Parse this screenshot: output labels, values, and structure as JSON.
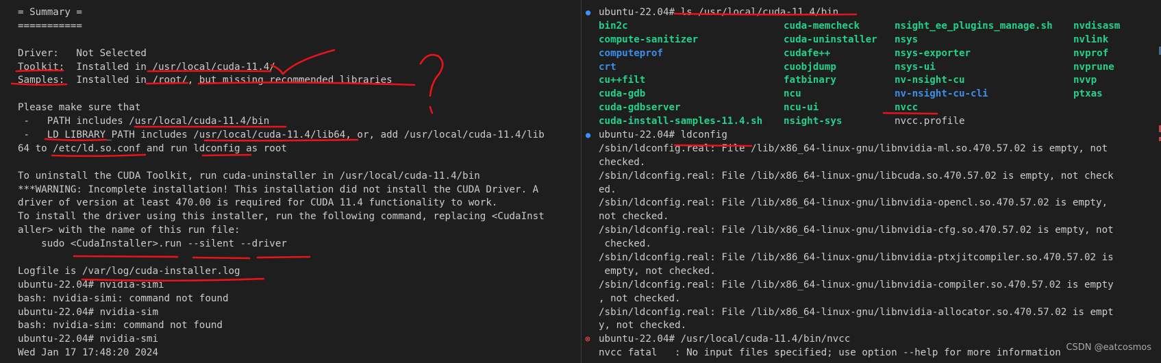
{
  "left_terminal": {
    "lines": [
      "= Summary =",
      "===========",
      "",
      "Driver:   Not Selected",
      "Toolkit:  Installed in /usr/local/cuda-11.4/",
      "Samples:  Installed in /root/, but missing recommended libraries",
      "",
      "Please make sure that",
      " -   PATH includes /usr/local/cuda-11.4/bin",
      " -   LD_LIBRARY_PATH includes /usr/local/cuda-11.4/lib64, or, add /usr/local/cuda-11.4/lib",
      "64 to /etc/ld.so.conf and run ldconfig as root",
      "",
      "To uninstall the CUDA Toolkit, run cuda-uninstaller in /usr/local/cuda-11.4/bin",
      "***WARNING: Incomplete installation! This installation did not install the CUDA Driver. A",
      "driver of version at least 470.00 is required for CUDA 11.4 functionality to work.",
      "To install the driver using this installer, run the following command, replacing <CudaInst",
      "aller> with the name of this run file:",
      "    sudo <CudaInstaller>.run --silent --driver",
      "",
      "Logfile is /var/log/cuda-installer.log",
      "ubuntu-22.04# nvidia-simi",
      "bash: nvidia-simi: command not found",
      "ubuntu-22.04# nvidia-sim",
      "bash: nvidia-sim: command not found",
      "ubuntu-22.04# nvidia-smi",
      "Wed Jan 17 17:48:20 2024"
    ]
  },
  "right_terminal": {
    "prompt1": "ubuntu-22.04# ls /usr/local/cuda-11.4/bin",
    "ls_entries": [
      {
        "name": "bin2c",
        "color": "green"
      },
      {
        "name": "cuda-memcheck",
        "color": "green"
      },
      {
        "name": "nsight_ee_plugins_manage.sh",
        "color": "green"
      },
      {
        "name": "nvdisasm",
        "color": "green"
      },
      {
        "name": "compute-sanitizer",
        "color": "green"
      },
      {
        "name": "cuda-uninstaller",
        "color": "green"
      },
      {
        "name": "nsys",
        "color": "green"
      },
      {
        "name": "nvlink",
        "color": "green"
      },
      {
        "name": "computeprof",
        "color": "blue"
      },
      {
        "name": "cudafe++",
        "color": "green"
      },
      {
        "name": "nsys-exporter",
        "color": "green"
      },
      {
        "name": "nvprof",
        "color": "green"
      },
      {
        "name": "crt",
        "color": "blue"
      },
      {
        "name": "cuobjdump",
        "color": "green"
      },
      {
        "name": "nsys-ui",
        "color": "green"
      },
      {
        "name": "nvprune",
        "color": "green"
      },
      {
        "name": "cu++filt",
        "color": "green"
      },
      {
        "name": "fatbinary",
        "color": "green"
      },
      {
        "name": "nv-nsight-cu",
        "color": "green"
      },
      {
        "name": "nvvp",
        "color": "green"
      },
      {
        "name": "cuda-gdb",
        "color": "green"
      },
      {
        "name": "ncu",
        "color": "green"
      },
      {
        "name": "nv-nsight-cu-cli",
        "color": "blue"
      },
      {
        "name": "ptxas",
        "color": "green"
      },
      {
        "name": "cuda-gdbserver",
        "color": "green"
      },
      {
        "name": "ncu-ui",
        "color": "green"
      },
      {
        "name": "nvcc",
        "color": "green"
      },
      {
        "name": "",
        "color": "plain"
      },
      {
        "name": "cuda-install-samples-11.4.sh",
        "color": "green"
      },
      {
        "name": "nsight-sys",
        "color": "green"
      },
      {
        "name": "nvcc.profile",
        "color": "plain"
      },
      {
        "name": "",
        "color": "plain"
      }
    ],
    "prompt2": "ubuntu-22.04# ldconfig",
    "ldconfig_lines": [
      "/sbin/ldconfig.real: File /lib/x86_64-linux-gnu/libnvidia-ml.so.470.57.02 is empty, not",
      "checked.",
      "/sbin/ldconfig.real: File /lib/x86_64-linux-gnu/libcuda.so.470.57.02 is empty, not check",
      "ed.",
      "/sbin/ldconfig.real: File /lib/x86_64-linux-gnu/libnvidia-opencl.so.470.57.02 is empty,",
      "not checked.",
      "/sbin/ldconfig.real: File /lib/x86_64-linux-gnu/libnvidia-cfg.so.470.57.02 is empty, not",
      " checked.",
      "/sbin/ldconfig.real: File /lib/x86_64-linux-gnu/libnvidia-ptxjitcompiler.so.470.57.02 is",
      " empty, not checked.",
      "/sbin/ldconfig.real: File /lib/x86_64-linux-gnu/libnvidia-compiler.so.470.57.02 is empty",
      ", not checked.",
      "/sbin/ldconfig.real: File /lib/x86_64-linux-gnu/libnvidia-allocator.so.470.57.02 is empt",
      "y, not checked."
    ],
    "prompt3": "ubuntu-22.04# /usr/local/cuda-11.4/bin/nvcc",
    "nvcc_error": "nvcc fatal   : No input files specified; use option --help for more information",
    "success_dot": "●",
    "error_dot": "⊗"
  },
  "watermark": "CSDN @eatcosmos",
  "colors": {
    "background": "#1e1e1e",
    "foreground": "#cccccc",
    "ls_green": "#23d18b",
    "ls_blue": "#3b8eea",
    "annotation_red": "#e8141c"
  }
}
